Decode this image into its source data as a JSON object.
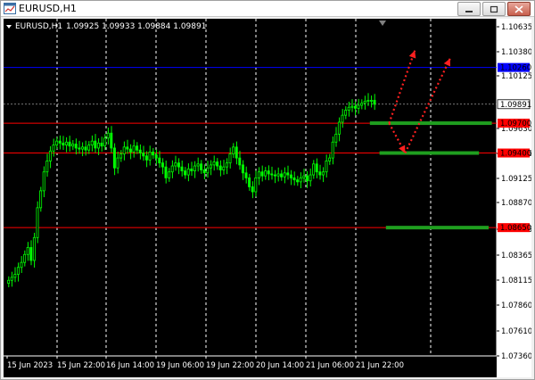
{
  "window": {
    "title": "EURUSD,H1",
    "icon": "chart-window-icon",
    "buttons": [
      "minimize-icon",
      "maximize-icon",
      "close-icon"
    ]
  },
  "info_bar": {
    "symbol": "EURUSD,H1",
    "ohlc": "1.09925 1.09933 1.09884 1.09891"
  },
  "colors": {
    "background": "#000000",
    "bull_candle": "#00ff00",
    "grid": "#ffffff",
    "resistance_line": "#ff0000",
    "top_line": "#0000ff",
    "zone_bar": "#1f9e1f",
    "arrow": "#ff2020",
    "current_price_line": "#c0c0c0"
  },
  "chart_data": {
    "type": "candlestick",
    "symbol": "EURUSD",
    "timeframe": "H1",
    "y_ticks": [
      "1.10635",
      "1.10380",
      "1.10125",
      "1.09630",
      "1.09375",
      "1.09125",
      "1.08870",
      "1.08615",
      "1.08365",
      "1.08115",
      "1.07860",
      "1.07610",
      "1.07360"
    ],
    "ylim": [
      1.0736,
      1.1075
    ],
    "x_ticks": [
      "15 Jun 2023",
      "15 Jun 22:00",
      "16 Jun 14:00",
      "19 Jun 06:00",
      "19 Jun 22:00",
      "20 Jun 14:00",
      "21 Jun 06:00",
      "21 Jun 22:00"
    ],
    "current_price": 1.09891,
    "current_price_label": "1.09891",
    "horizontal_lines": [
      {
        "price": 1.1026,
        "label": "1.10260",
        "color": "#0000ff"
      },
      {
        "price": 1.097,
        "label": "1.09700",
        "color": "#ff0000"
      },
      {
        "price": 1.094,
        "label": "1.09400",
        "color": "#ff0000"
      },
      {
        "price": 1.0865,
        "label": "1.08650",
        "color": "#ff0000"
      }
    ],
    "zones": [
      {
        "price": 1.097,
        "from_bar": 113,
        "to_bar": 151
      },
      {
        "price": 1.094,
        "from_bar": 116,
        "to_bar": 147
      },
      {
        "price": 1.0865,
        "from_bar": 118,
        "to_bar": 150
      }
    ],
    "arrows": [
      {
        "from": [
          119,
          1.097
        ],
        "to": [
          124,
          1.094
        ]
      },
      {
        "from": [
          119,
          1.097
        ],
        "to": [
          127,
          1.1043
        ]
      },
      {
        "from": [
          124,
          1.094
        ],
        "to": [
          138,
          1.1035
        ]
      }
    ],
    "closes": [
      1.0812,
      1.0815,
      1.0818,
      1.0825,
      1.083,
      1.0838,
      1.0845,
      1.0832,
      1.0855,
      1.0885,
      1.0902,
      1.0921,
      1.0932,
      1.0942,
      1.0948,
      1.0952,
      1.095,
      1.0948,
      1.0951,
      1.0947,
      1.0949,
      1.0945,
      1.0944,
      1.0946,
      1.0943,
      1.0948,
      1.0952,
      1.0945,
      1.095,
      1.0947,
      1.0955,
      1.096,
      1.0945,
      1.0925,
      1.0935,
      1.0939,
      1.0946,
      1.0944,
      1.0941,
      1.0947,
      1.0943,
      1.094,
      1.0937,
      1.0933,
      1.0941,
      1.0938,
      1.0935,
      1.093,
      1.0926,
      1.0915,
      1.0921,
      1.0927,
      1.093,
      1.0926,
      1.0922,
      1.0918,
      1.0924,
      1.0922,
      1.0927,
      1.0929,
      1.0923,
      1.092,
      1.0925,
      1.0928,
      1.0931,
      1.0927,
      1.0923,
      1.0926,
      1.093,
      1.0939,
      1.0946,
      1.0935,
      1.0928,
      1.092,
      1.0915,
      1.0906,
      1.0901,
      1.0915,
      1.0921,
      1.0917,
      1.0922,
      1.0919,
      1.0918,
      1.0917,
      1.0919,
      1.0916,
      1.092,
      1.0918,
      1.0915,
      1.0913,
      1.0911,
      1.0915,
      1.0917,
      1.0912,
      1.0918,
      1.0929,
      1.0921,
      1.0918,
      1.0921,
      1.0932,
      1.0935,
      1.0951,
      1.0959,
      1.0971,
      1.0978,
      1.0983,
      1.0986,
      1.0987,
      1.0985,
      1.0988,
      1.099,
      1.0992,
      1.0993,
      1.0993,
      1.0989
    ]
  }
}
